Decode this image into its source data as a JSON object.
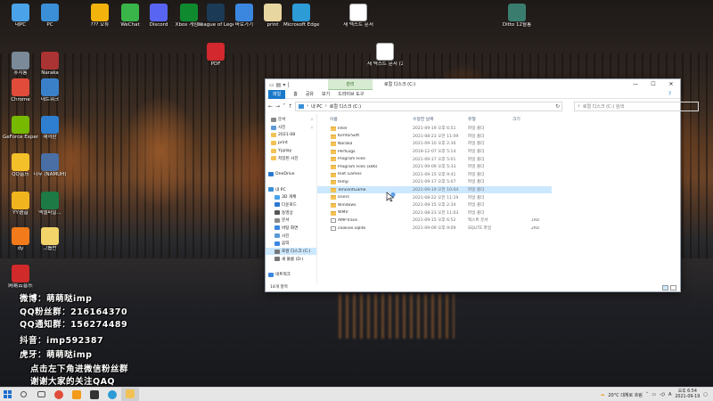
{
  "desktop": {
    "icons_left": [
      {
        "label": "내PC",
        "color": "#4aa3e8"
      },
      {
        "label": "PC",
        "color": "#3b8fd6"
      },
      {
        "label": "휴지통",
        "color": "#7a8a99"
      },
      {
        "label": "Naraka",
        "color": "#a33"
      },
      {
        "label": "Chrome",
        "color": "#e04b3a"
      },
      {
        "label": "네트워크",
        "color": "#3a80c9"
      },
      {
        "label": "GeForce Experience",
        "color": "#76b900"
      },
      {
        "label": "제어판",
        "color": "#2f7fd0"
      },
      {
        "label": "QQ音乐",
        "color": "#f3c02a"
      },
      {
        "label": "나무 (NAMUH)",
        "color": "#4a6fa5"
      },
      {
        "label": "YY语音",
        "color": "#f0b41f"
      },
      {
        "label": "엑셀파일...",
        "color": "#1d7a44"
      },
      {
        "label": "dy",
        "color": "#f27a1a"
      },
      {
        "label": "그룹반",
        "color": "#f2d46b"
      },
      {
        "label": "网易云音乐",
        "color": "#d12a2a"
      }
    ],
    "icons_top": [
      {
        "label": "??? 오류",
        "color": "#f2b40c"
      },
      {
        "label": "WeChat",
        "color": "#39b54a"
      },
      {
        "label": "Discord",
        "color": "#5865f2"
      },
      {
        "label": "Xbox 게임바",
        "color": "#0f8a2f"
      },
      {
        "label": "League of Legends",
        "color": "#1a3a55"
      },
      {
        "label": "바로가기",
        "color": "#3b87e0"
      },
      {
        "label": "print",
        "color": "#e8d6a0"
      },
      {
        "label": "Microsoft Edge",
        "color": "#2c9bd6"
      },
      {
        "label": "새 텍스트 문서",
        "color": "#ffffff"
      },
      {
        "label": "Ditto 12월통",
        "color": "#3a7d6f"
      },
      {
        "label": "새 텍스트 문서 (2)",
        "color": "#ffffff"
      },
      {
        "label": "PDF",
        "color": "#d2282e"
      }
    ]
  },
  "overlay_lines": [
    "微博：萌萌哒imp",
    "QQ粉丝群：216164370",
    "QQ通知群：156274489",
    "抖音：imp592387",
    "虎牙：萌萌哒imp",
    "点击左下角进微信粉丝群",
    "谢谢大家的关注QAQ"
  ],
  "explorer": {
    "context_tab": "관리",
    "title": "로컬 디스크 (C:)",
    "controls": {
      "minimize": "—",
      "maximize": "☐",
      "close": "✕"
    },
    "ribbon_tabs": [
      "파일",
      "홈",
      "공유",
      "보기",
      "드라이브 도구"
    ],
    "address": [
      "내 PC",
      "로컬 디스크 (C:)"
    ],
    "search_placeholder": "로컬 디스크 (C:) 검색",
    "nav": [
      {
        "label": "문서",
        "color": "#8a8a8a",
        "pin": true
      },
      {
        "label": "사진",
        "color": "#5b9bd5",
        "pin": true
      },
      {
        "label": "2021-08",
        "color": "#f2c255"
      },
      {
        "label": "print",
        "color": "#f2c255"
      },
      {
        "label": "Yyplay",
        "color": "#f2c255"
      },
      {
        "label": "저장된 사진",
        "color": "#f2c255"
      },
      {
        "label": "",
        "color": "transparent"
      },
      {
        "label": "OneDrive",
        "color": "#2a78d0"
      },
      {
        "label": "",
        "color": "transparent"
      },
      {
        "label": "내 PC",
        "color": "#3b8fd6"
      },
      {
        "label": "3D 개체",
        "color": "#4aa3e8"
      },
      {
        "label": "다운로드",
        "color": "#2a78d0"
      },
      {
        "label": "동영상",
        "color": "#555"
      },
      {
        "label": "문서",
        "color": "#8a8a8a"
      },
      {
        "label": "바탕 화면",
        "color": "#3b87e0"
      },
      {
        "label": "사진",
        "color": "#5b9bd5"
      },
      {
        "label": "음악",
        "color": "#3b87e0"
      },
      {
        "label": "로컬 디스크 (C:)",
        "color": "#777",
        "selected": true
      },
      {
        "label": "새 볼륨 (D:)",
        "color": "#777"
      },
      {
        "label": "",
        "color": "transparent"
      },
      {
        "label": "네트워크",
        "color": "#3b87e0"
      }
    ],
    "columns": [
      "이름",
      "수정한 날짜",
      "유형",
      "크기"
    ],
    "files": [
      {
        "name": "Intel",
        "date": "2021-09-19 오후 6:51",
        "type": "파일 폴더",
        "size": "",
        "kind": "folder"
      },
      {
        "name": "KimforSoft",
        "date": "2021-08-23 오전 11:09",
        "type": "파일 폴더",
        "size": "",
        "kind": "folder"
      },
      {
        "name": "Naraka",
        "date": "2021-09-10 오후 2:30",
        "type": "파일 폴더",
        "size": "",
        "kind": "folder"
      },
      {
        "name": "PerfLogs",
        "date": "2019-12-07 오후 5:14",
        "type": "파일 폴더",
        "size": "",
        "kind": "folder"
      },
      {
        "name": "Program Files",
        "date": "2021-09-17 오후 5:01",
        "type": "파일 폴더",
        "size": "",
        "kind": "folder"
      },
      {
        "name": "Program Files (x86)",
        "date": "2021-09-09 오후 5:33",
        "type": "파일 폴더",
        "size": "",
        "kind": "folder"
      },
      {
        "name": "Riot Games",
        "date": "2021-09-15 오후 9:41",
        "type": "파일 폴더",
        "size": "",
        "kind": "folder"
      },
      {
        "name": "temp",
        "date": "2021-09-17 오후 5:07",
        "type": "파일 폴더",
        "size": "",
        "kind": "folder"
      },
      {
        "name": "TencentGame",
        "date": "2021-09-19 오전 10:04",
        "type": "파일 폴더",
        "size": "",
        "kind": "folder",
        "highlight": true
      },
      {
        "name": "Users",
        "date": "2021-08-22 오전 11:19",
        "type": "파일 폴더",
        "size": "",
        "kind": "folder"
      },
      {
        "name": "Windows",
        "date": "2021-09-15 오후 2:34",
        "type": "파일 폴더",
        "size": "",
        "kind": "folder"
      },
      {
        "name": "WMV",
        "date": "2021-08-23 오전 11:03",
        "type": "파일 폴더",
        "size": "",
        "kind": "folder"
      },
      {
        "name": "AMPTrace",
        "date": "2021-09-15 오후 6:52",
        "type": "텍스트 문서",
        "size": "1KB",
        "kind": "file"
      },
      {
        "name": "cookies.sqlite",
        "date": "2021-09-09 오후 9:09",
        "type": "SQLITE 파일",
        "size": "2KB",
        "kind": "file"
      }
    ],
    "status": "14개 항목"
  },
  "taskbar": {
    "apps": [
      {
        "name": "search",
        "color": "#555"
      },
      {
        "name": "task-view",
        "color": "#555"
      },
      {
        "name": "chrome",
        "color": "#e04b3a"
      },
      {
        "name": "app-orange",
        "color": "#f29a1a"
      },
      {
        "name": "app-game",
        "color": "#333"
      },
      {
        "name": "edge",
        "color": "#2c9bd6"
      },
      {
        "name": "file-explorer",
        "color": "#f2c255"
      }
    ],
    "weather": "20°C 대체로 흐림",
    "lang": "A",
    "time": "오후 6:54",
    "date": "2021-09-19"
  }
}
